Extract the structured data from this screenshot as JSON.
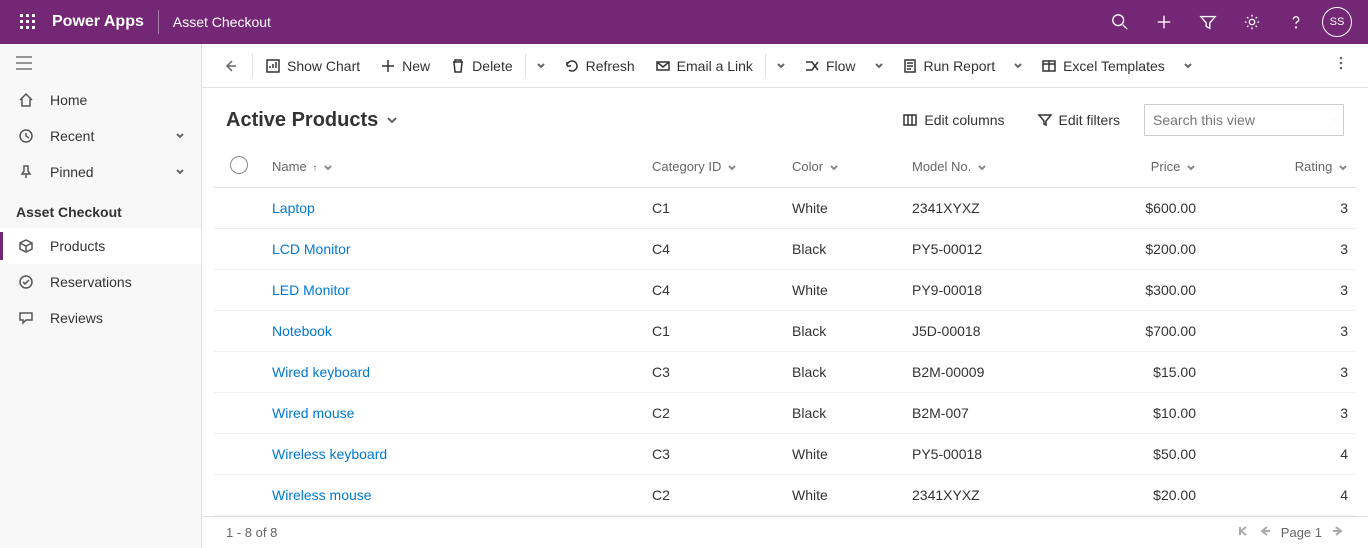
{
  "header": {
    "app_name": "Power Apps",
    "env_name": "Asset Checkout",
    "avatar_initials": "SS"
  },
  "sidebar": {
    "home": "Home",
    "recent": "Recent",
    "pinned": "Pinned",
    "section": "Asset Checkout",
    "items": [
      {
        "label": "Products"
      },
      {
        "label": "Reservations"
      },
      {
        "label": "Reviews"
      }
    ]
  },
  "commands": {
    "show_chart": "Show Chart",
    "new": "New",
    "delete": "Delete",
    "refresh": "Refresh",
    "email_link": "Email a Link",
    "flow": "Flow",
    "run_report": "Run Report",
    "excel_templates": "Excel Templates"
  },
  "view": {
    "title": "Active Products",
    "edit_columns": "Edit columns",
    "edit_filters": "Edit filters",
    "search_placeholder": "Search this view"
  },
  "columns": {
    "name": "Name",
    "category_id": "Category ID",
    "color": "Color",
    "model_no": "Model No.",
    "price": "Price",
    "rating": "Rating"
  },
  "rows": [
    {
      "name": "Laptop",
      "category": "C1",
      "color": "White",
      "model": "2341XYXZ",
      "price": "$600.00",
      "rating": "3"
    },
    {
      "name": "LCD Monitor",
      "category": "C4",
      "color": "Black",
      "model": "PY5-00012",
      "price": "$200.00",
      "rating": "3"
    },
    {
      "name": "LED Monitor",
      "category": "C4",
      "color": "White",
      "model": "PY9-00018",
      "price": "$300.00",
      "rating": "3"
    },
    {
      "name": "Notebook",
      "category": "C1",
      "color": "Black",
      "model": "J5D-00018",
      "price": "$700.00",
      "rating": "3"
    },
    {
      "name": "Wired keyboard",
      "category": "C3",
      "color": "Black",
      "model": "B2M-00009",
      "price": "$15.00",
      "rating": "3"
    },
    {
      "name": "Wired mouse",
      "category": "C2",
      "color": "Black",
      "model": "B2M-007",
      "price": "$10.00",
      "rating": "3"
    },
    {
      "name": "Wireless keyboard",
      "category": "C3",
      "color": "White",
      "model": "PY5-00018",
      "price": "$50.00",
      "rating": "4"
    },
    {
      "name": "Wireless mouse",
      "category": "C2",
      "color": "White",
      "model": "2341XYXZ",
      "price": "$20.00",
      "rating": "4"
    }
  ],
  "footer": {
    "range": "1 - 8 of 8",
    "page": "Page 1"
  }
}
